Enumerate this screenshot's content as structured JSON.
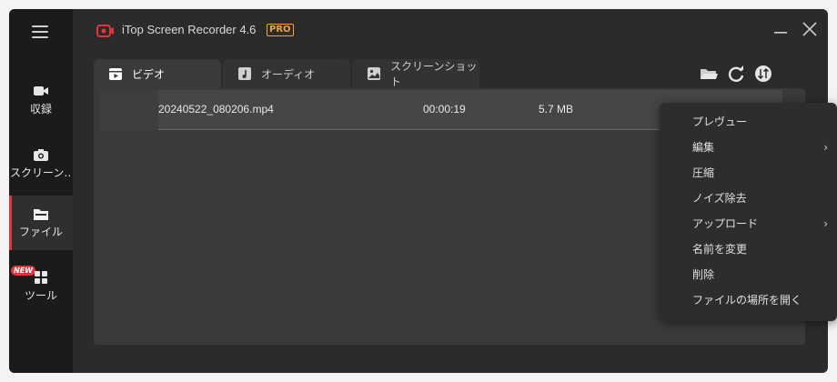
{
  "window": {
    "title": "iTop Screen Recorder 4.6",
    "badge": "PRO"
  },
  "sidebar": {
    "items": [
      {
        "label": "収録",
        "icon": "video-camera-icon"
      },
      {
        "label": "スクリーン…",
        "icon": "camera-icon"
      },
      {
        "label": "ファイル",
        "icon": "folder-icon",
        "active": true
      },
      {
        "label": "ツール",
        "icon": "grid-icon",
        "badge": "NEW"
      }
    ]
  },
  "tabs": [
    {
      "label": "ビデオ",
      "icon": "video-clapper-icon",
      "active": true
    },
    {
      "label": "オーディオ",
      "icon": "music-note-icon"
    },
    {
      "label": "スクリーンショット",
      "icon": "image-icon"
    }
  ],
  "files": [
    {
      "name": "20240522_080206.mp4",
      "duration": "00:00:19",
      "size": "5.7 MB"
    }
  ],
  "context_menu": {
    "items": [
      {
        "label": "プレヴュー"
      },
      {
        "label": "編集",
        "submenu": "›"
      },
      {
        "label": "圧縮"
      },
      {
        "label": "ノイズ除去"
      },
      {
        "label": "アップロード",
        "submenu": "›"
      },
      {
        "label": "名前を変更"
      },
      {
        "label": "削除"
      },
      {
        "label": "ファイルの場所を開く"
      }
    ]
  },
  "colors": {
    "accent": "#e0353d",
    "pro": "#f0a33a",
    "background": "#2b2b2b",
    "sidebar": "#1b1b1b"
  }
}
